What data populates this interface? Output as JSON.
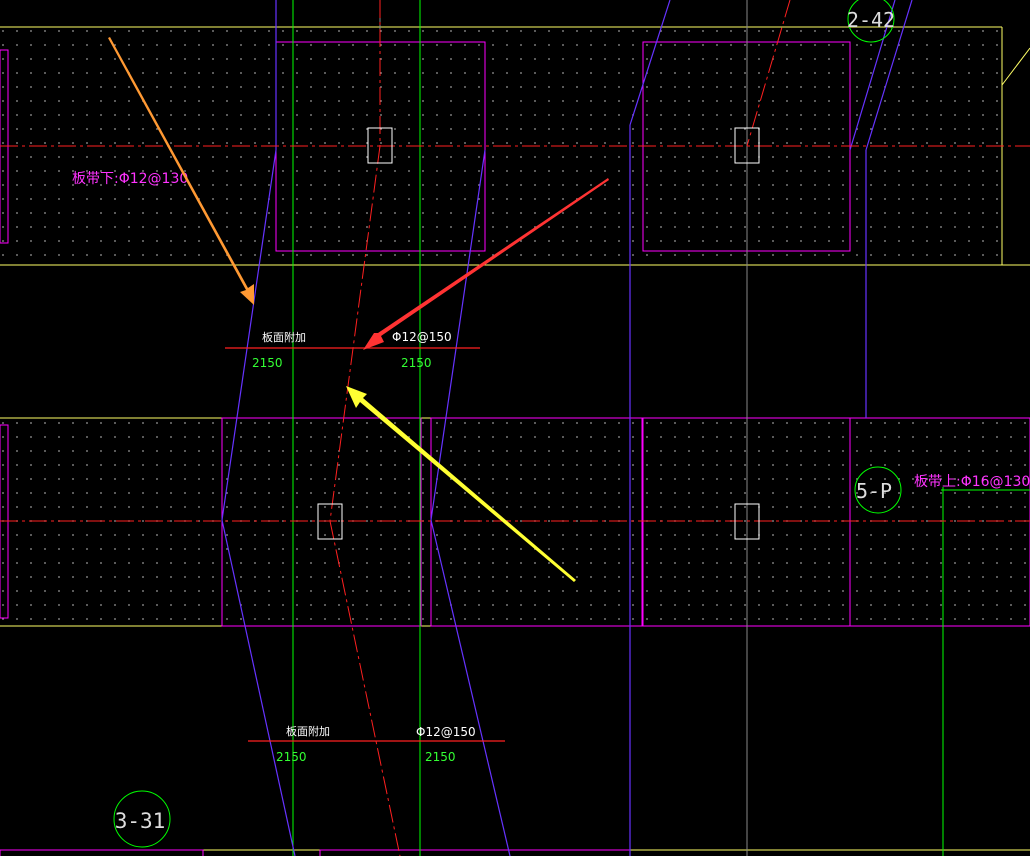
{
  "colors": {
    "background": "#000000",
    "strip": "#ffff66",
    "panel": "#ff00ff",
    "grid_red": "#ff2020",
    "grid_green": "#00ff00",
    "slab_edge_blue": "#6633ff",
    "text_magenta": "#ff33ff",
    "text_white": "#ffffff",
    "text_green": "#33ff33",
    "bubble": "#00ff00",
    "dots": "#9a9a9a",
    "arrow_orange": "#ff9933",
    "arrow_red": "#ff3333",
    "arrow_yellow": "#ffff33"
  },
  "grid_bubbles": [
    {
      "id": "top",
      "label": "2-42"
    },
    {
      "id": "right",
      "label": "5-P"
    },
    {
      "id": "bottom",
      "label": "3-31"
    }
  ],
  "rebar_labels": {
    "bottom_strip": "板带下:Φ12@130",
    "top_strip": "板带上:Φ16@130"
  },
  "additional_rebar": [
    {
      "id": "upper",
      "title": "板面附加",
      "spec": "Φ12@150",
      "length_left": "2150",
      "length_right": "2150"
    },
    {
      "id": "lower",
      "title": "板面附加",
      "spec": "Φ12@150",
      "length_left": "2150",
      "length_right": "2150"
    }
  ],
  "callout_arrows": [
    {
      "id": "orange",
      "icon": "orange-arrow-icon"
    },
    {
      "id": "red",
      "icon": "red-arrow-icon"
    },
    {
      "id": "yellow",
      "icon": "yellow-arrow-icon"
    }
  ]
}
